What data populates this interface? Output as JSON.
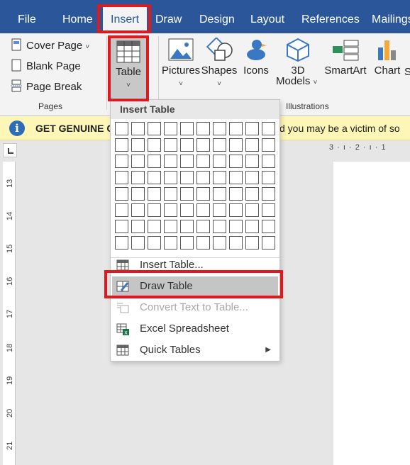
{
  "tabs": [
    {
      "label": "File",
      "active": false
    },
    {
      "label": "Home",
      "active": false
    },
    {
      "label": "Insert",
      "active": true
    },
    {
      "label": "Draw",
      "active": false
    },
    {
      "label": "Design",
      "active": false
    },
    {
      "label": "Layout",
      "active": false
    },
    {
      "label": "References",
      "active": false
    },
    {
      "label": "Mailings",
      "active": false
    }
  ],
  "ribbon": {
    "pages_group": {
      "cover_page": "Cover Page",
      "blank_page": "Blank Page",
      "page_break": "Page Break",
      "label": "Pages"
    },
    "table_button": "Table",
    "illustrations_group": {
      "pictures": "Pictures",
      "shapes": "Shapes",
      "icons": "Icons",
      "models_line1": "3D",
      "models_line2": "Models",
      "smartart": "SmartArt",
      "chart": "Chart",
      "label": "Illustrations"
    }
  },
  "infobar": {
    "text_left": "GET GENUINE C",
    "text_right": "d you may be a victim of so"
  },
  "ruler": {
    "horizontal": "3 · ı · 2 · ı · 1",
    "vertical": [
      "13",
      "14",
      "15",
      "16",
      "17",
      "18",
      "19",
      "20",
      "21"
    ]
  },
  "dropdown": {
    "title": "Insert Table",
    "grid_cols": 10,
    "grid_rows": 8,
    "items": [
      {
        "label": "Insert Table...",
        "icon": "insert-table-icon",
        "disabled": false
      },
      {
        "label": "Draw Table",
        "icon": "draw-table-icon",
        "disabled": false,
        "hover": true
      },
      {
        "label": "Convert Text to Table...",
        "icon": "convert-text-icon",
        "disabled": true
      },
      {
        "label": "Excel Spreadsheet",
        "icon": "excel-icon",
        "disabled": false
      },
      {
        "label": "Quick Tables",
        "icon": "quick-tables-icon",
        "disabled": false,
        "submenu": true
      }
    ]
  },
  "colors": {
    "tabbar": "#2b579a",
    "highlight": "#e0191f",
    "infobar": "#fdf6b7"
  }
}
